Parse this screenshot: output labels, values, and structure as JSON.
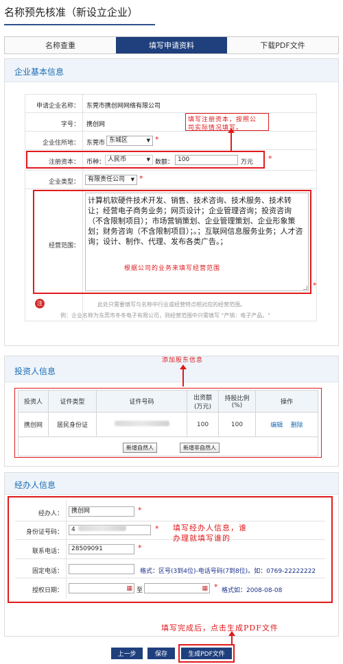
{
  "page_title": "名称预先核准（新设立企业）",
  "tabs": [
    {
      "label": "名称查重",
      "active": false
    },
    {
      "label": "填写申请资料",
      "active": true
    },
    {
      "label": "下载PDF文件",
      "active": false
    }
  ],
  "company": {
    "section_title": "企业基本信息",
    "fields": {
      "applicant_name_label": "申请企业名称：",
      "applicant_name": "东莞市携创网网络有限公司",
      "trade_name_label": "字号：",
      "trade_name": "携创网",
      "address_label": "企业住所地：",
      "city": "东莞市",
      "district": "东城区",
      "capital_label": "注册资本：",
      "currency_label": "币种：",
      "currency": "人民币",
      "amount_label": "数额：",
      "amount": "100",
      "amount_unit": "万元",
      "type_label": "企业类型：",
      "type": "有限责任公司",
      "scope_label": "经营范围：",
      "scope": "计算机软硬件技术开发、销售、技术咨询、技术服务、技术转让；经营电子商务业务；网页设计；企业管理咨询；投资咨询（不含限制项目）；市场营销策划、企业管理策划、企业形象策划；财务咨询（不含限制项目）；。；互联网信息服务业务；人才咨询；设计、制作、代理、发布各类广告。；"
    },
    "note_badge": "注",
    "note_line1": "此处只需要填写与名称中行业或经营特点相对应的经营范围。",
    "note_line2": "例：企业名称为东莞市冬冬电子有限公司，则经营范围中只需填写 \"产销：电子产品。\""
  },
  "annotations": {
    "capital_note_1": "填写注册资本，按照公",
    "capital_note_2": "司实际情况填写。",
    "scope_note": "根据公司的业务来填写经营范围",
    "investor_note": "添加股东信息",
    "agent_note_1": "填写经办人信息，谁",
    "agent_note_2": "办理就填写谁的",
    "finish_note": "填写完成后，点击生成PDF文件"
  },
  "investors": {
    "section_title": "投资人信息",
    "headers": [
      "投资人",
      "证件类型",
      "证件号码",
      "出资额\n(万元)",
      "持股比例\n(%)",
      "操作"
    ],
    "rows": [
      {
        "investor": "携创网",
        "id_type": "居民身份证",
        "contribution": "100",
        "ratio": "100",
        "edit": "编辑",
        "delete": "删除"
      }
    ],
    "add_natural": "新增自然人",
    "add_non_natural": "新增非自然人"
  },
  "agent": {
    "section_title": "经办人信息",
    "name_label": "经办人：",
    "name": "携创网",
    "id_label": "身份证号码：",
    "id_prefix": "4",
    "phone_label": "联系电话：",
    "phone": "28509091",
    "landline_label": "固定电话：",
    "landline_hint": "格式：区号(3到4位)-电话号码(7到8位)。如：0769-22222222",
    "auth_date_label": "授权日期：",
    "date_to": "至",
    "date_hint": "格式如：2008-08-08"
  },
  "buttons": {
    "prev": "上一步",
    "save": "保存",
    "generate_pdf": "生成PDF文件"
  },
  "colors": {
    "brand": "#1f3f7d",
    "annotation": "#e0181b",
    "link": "#1b6bb5"
  }
}
